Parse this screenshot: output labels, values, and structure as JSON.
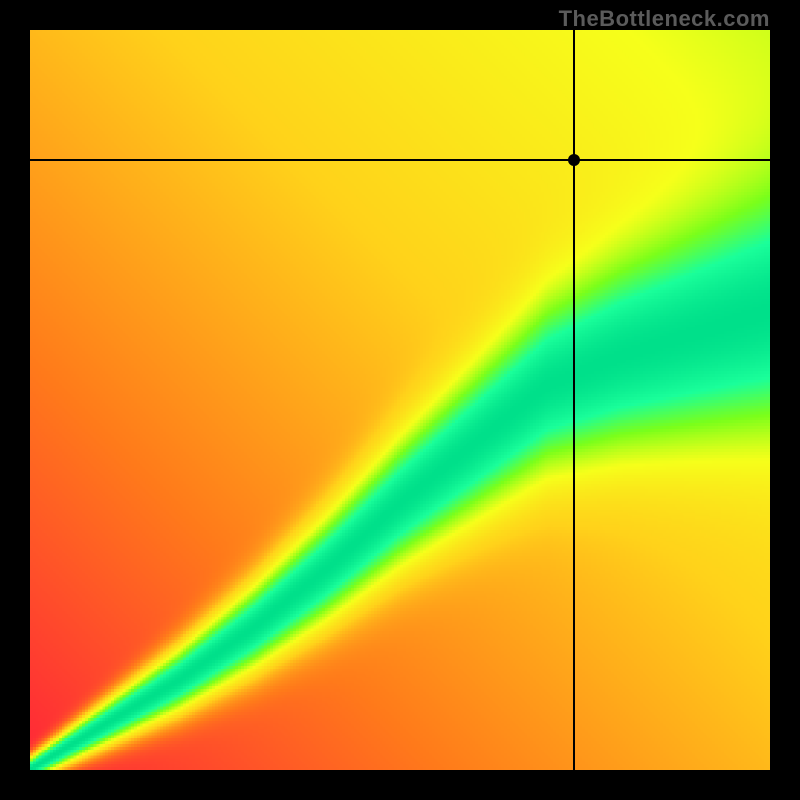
{
  "watermark": "TheBottleneck.com",
  "chart_data": {
    "type": "heatmap",
    "title": "",
    "xlabel": "",
    "ylabel": "",
    "xlim": [
      0,
      1
    ],
    "ylim": [
      0,
      1
    ],
    "marker": {
      "x": 0.735,
      "y": 0.825
    },
    "crosshair": {
      "x": 0.735,
      "y": 0.825
    },
    "colormap": [
      "#ff1a3c",
      "#ff7a1a",
      "#ffd21a",
      "#f6ff1a",
      "#7aff1a",
      "#1aff9a",
      "#00e08a"
    ],
    "ridge": {
      "comment": "approximate green ridge center as y = f(x), normalized 0..1",
      "x": [
        0.0,
        0.1,
        0.2,
        0.3,
        0.4,
        0.5,
        0.6,
        0.7,
        0.8,
        0.9,
        1.0
      ],
      "y": [
        0.0,
        0.06,
        0.12,
        0.19,
        0.27,
        0.36,
        0.44,
        0.52,
        0.56,
        0.59,
        0.62
      ]
    },
    "ridge_width": 0.06
  }
}
